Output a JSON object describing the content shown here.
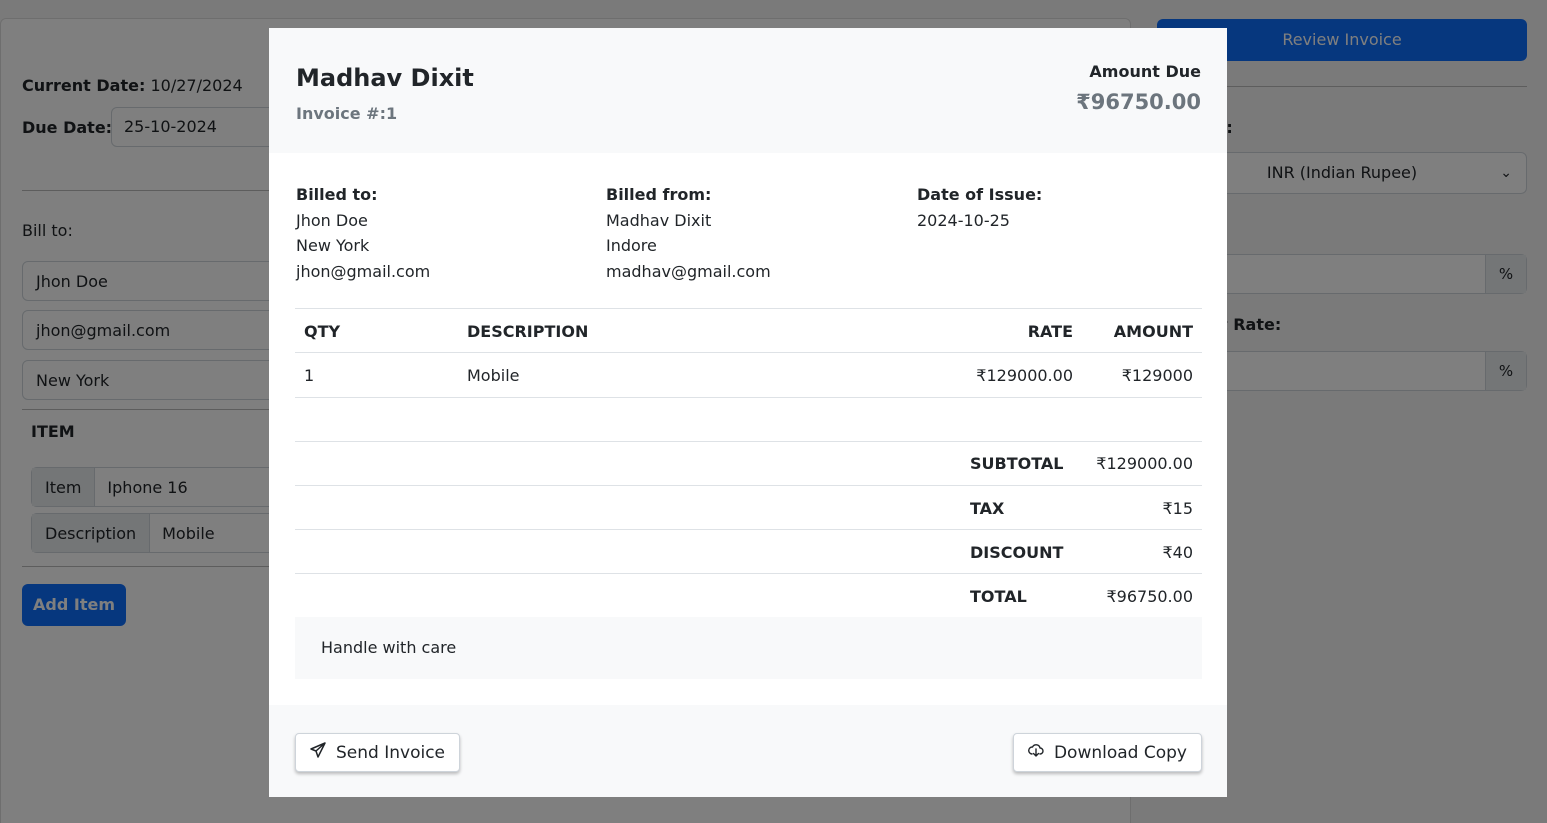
{
  "form": {
    "current_date_label": "Current Date:",
    "current_date_value": "10/27/2024",
    "due_date_label": "Due Date:",
    "due_date_value": "25-10-2024",
    "bill_to_label": "Bill to:",
    "bill_to_name": "Jhon Doe",
    "bill_to_email": "jhon@gmail.com",
    "bill_to_address": "New York",
    "item_header": "ITEM",
    "item_addon": "Item",
    "item_value": "Iphone 16",
    "desc_addon": "Description",
    "desc_value": "Mobile",
    "add_item_label": "Add Item"
  },
  "sidebar": {
    "review_label": "Review Invoice",
    "currency_label_partial": "y:",
    "currency_value": "INR (Indian Rupee)",
    "tax_label_partial": ":",
    "discount_label_partial": "t Rate:",
    "percent": "%"
  },
  "modal": {
    "name": "Madhav Dixit",
    "invoice_no": "Invoice #:1",
    "amount_due_label": "Amount Due",
    "amount_due_value": "₹96750.00",
    "billed_to": {
      "heading": "Billed to:",
      "name": "Jhon Doe",
      "address": "New York",
      "email": "jhon@gmail.com"
    },
    "billed_from": {
      "heading": "Billed from:",
      "name": "Madhav Dixit",
      "address": "Indore",
      "email": "madhav@gmail.com"
    },
    "issue": {
      "heading": "Date of Issue:",
      "date": "2024-10-25"
    },
    "table": {
      "headers": {
        "qty": "QTY",
        "description": "DESCRIPTION",
        "rate": "RATE",
        "amount": "AMOUNT"
      },
      "rows": [
        {
          "qty": "1",
          "description": "Mobile",
          "rate": "₹129000.00",
          "amount": "₹129000"
        }
      ]
    },
    "totals": {
      "subtotal_label": "SUBTOTAL",
      "subtotal_value": "₹129000.00",
      "tax_label": "TAX",
      "tax_value": "₹15",
      "discount_label": "DISCOUNT",
      "discount_value": "₹40",
      "total_label": "TOTAL",
      "total_value": "₹96750.00"
    },
    "notes": "Handle with care",
    "send_label": "Send Invoice",
    "download_label": "Download Copy"
  }
}
